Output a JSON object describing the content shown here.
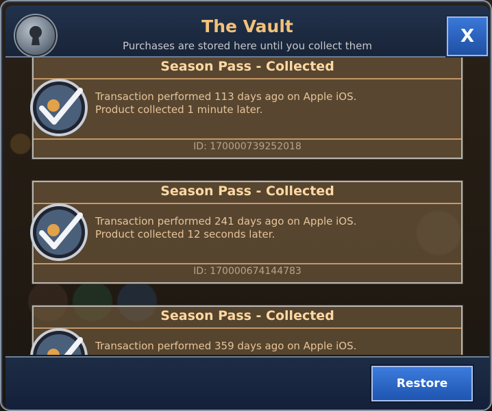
{
  "header": {
    "title": "The Vault",
    "subtitle": "Purchases are stored here until you collect them",
    "close_label": "X"
  },
  "icons": {
    "vault": "keyhole-icon",
    "item": "season-pass-checkmark-icon"
  },
  "colors": {
    "title": "#f1c27a",
    "accent_blue": "#2a66c8",
    "card_text": "#e6c49a"
  },
  "purchases": [
    {
      "title": "Season Pass - Collected",
      "line1": "Transaction performed 113 days ago on Apple iOS.",
      "line2": "Product collected 1 minute later.",
      "id": "ID: 170000739252018"
    },
    {
      "title": "Season Pass - Collected",
      "line1": "Transaction performed 241 days ago on Apple iOS.",
      "line2": "Product collected 12 seconds later.",
      "id": "ID: 170000674144783"
    },
    {
      "title": "Season Pass - Collected",
      "line1": "Transaction performed 359 days ago on Apple iOS.",
      "line2": "",
      "id": ""
    }
  ],
  "footer": {
    "restore_label": "Restore"
  }
}
